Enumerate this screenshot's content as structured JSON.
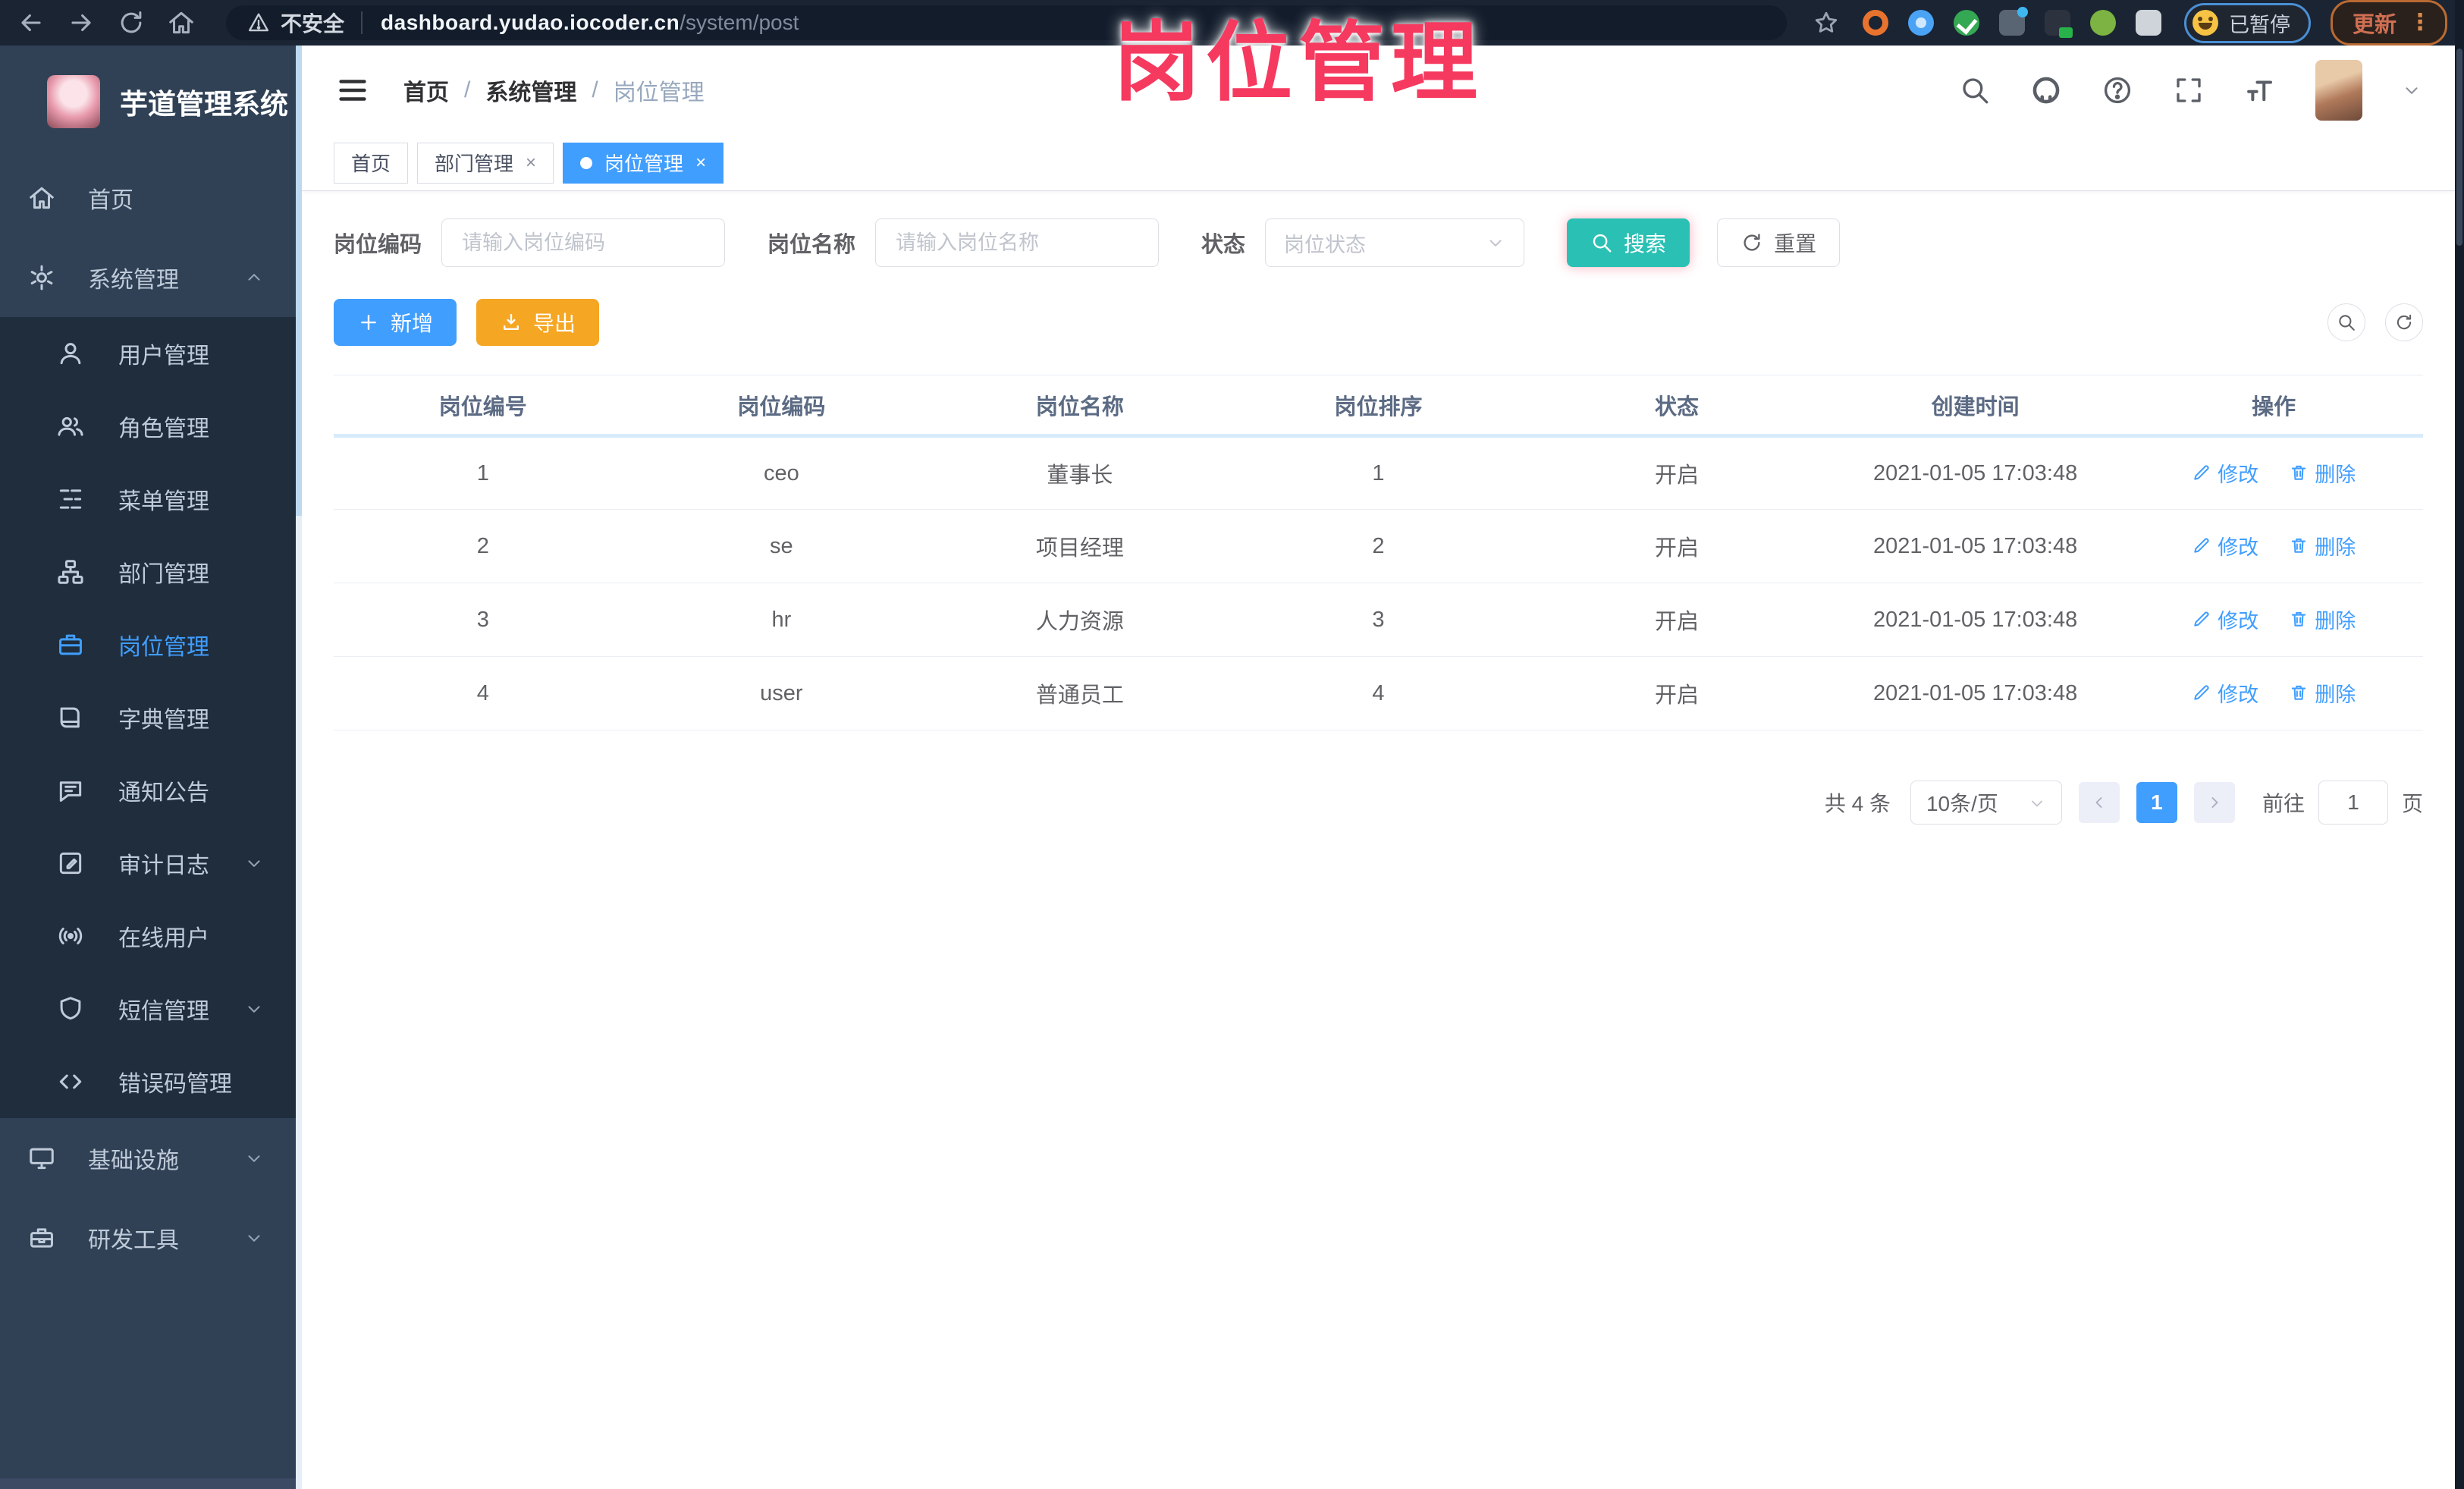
{
  "colors": {
    "primary": "#409EFF",
    "search_teal": "#2BC0B4",
    "export_orange": "#F5A623",
    "watermark_pink": "#F5395F",
    "sidebar_bg": "#304156",
    "submenu_bg": "#1F2D3D"
  },
  "watermark": "岗位管理",
  "browser": {
    "security_label": "不安全",
    "url_host": "dashboard.yudao.iocoder.cn",
    "url_path": "/system/post",
    "paused_label": "已暂停",
    "update_label": "更新",
    "menu_dots": "⋮"
  },
  "sidebar": {
    "title": "芋道管理系统",
    "items": [
      "首页",
      "系统管理",
      "用户管理",
      "角色管理",
      "菜单管理",
      "部门管理",
      "岗位管理",
      "字典管理",
      "通知公告",
      "审计日志",
      "在线用户",
      "短信管理",
      "错误码管理",
      "基础设施",
      "研发工具"
    ]
  },
  "breadcrumb": {
    "items": [
      "首页",
      "系统管理",
      "岗位管理"
    ],
    "separator": "/"
  },
  "tabs": {
    "home": "首页",
    "dept": "部门管理",
    "post": "岗位管理",
    "close": "×"
  },
  "filters": {
    "code_label": "岗位编码",
    "code_placeholder": "请输入岗位编码",
    "name_label": "岗位名称",
    "name_placeholder": "请输入岗位名称",
    "status_label": "状态",
    "status_placeholder": "岗位状态",
    "search_label": "搜索",
    "reset_label": "重置"
  },
  "toolbar": {
    "add_label": "新增",
    "export_label": "导出"
  },
  "table": {
    "columns": [
      "岗位编号",
      "岗位编码",
      "岗位名称",
      "岗位排序",
      "状态",
      "创建时间",
      "操作"
    ],
    "edit_label": "修改",
    "delete_label": "删除",
    "rows": [
      {
        "no": "1",
        "code": "ceo",
        "name": "董事长",
        "sort": "1",
        "status": "开启",
        "created": "2021-01-05 17:03:48"
      },
      {
        "no": "2",
        "code": "se",
        "name": "项目经理",
        "sort": "2",
        "status": "开启",
        "created": "2021-01-05 17:03:48"
      },
      {
        "no": "3",
        "code": "hr",
        "name": "人力资源",
        "sort": "3",
        "status": "开启",
        "created": "2021-01-05 17:03:48"
      },
      {
        "no": "4",
        "code": "user",
        "name": "普通员工",
        "sort": "4",
        "status": "开启",
        "created": "2021-01-05 17:03:48"
      }
    ]
  },
  "pagination": {
    "total": "共 4 条",
    "page_size": "10条/页",
    "current_page": "1",
    "goto_label": "前往",
    "goto_value": "1",
    "page_unit": "页"
  }
}
